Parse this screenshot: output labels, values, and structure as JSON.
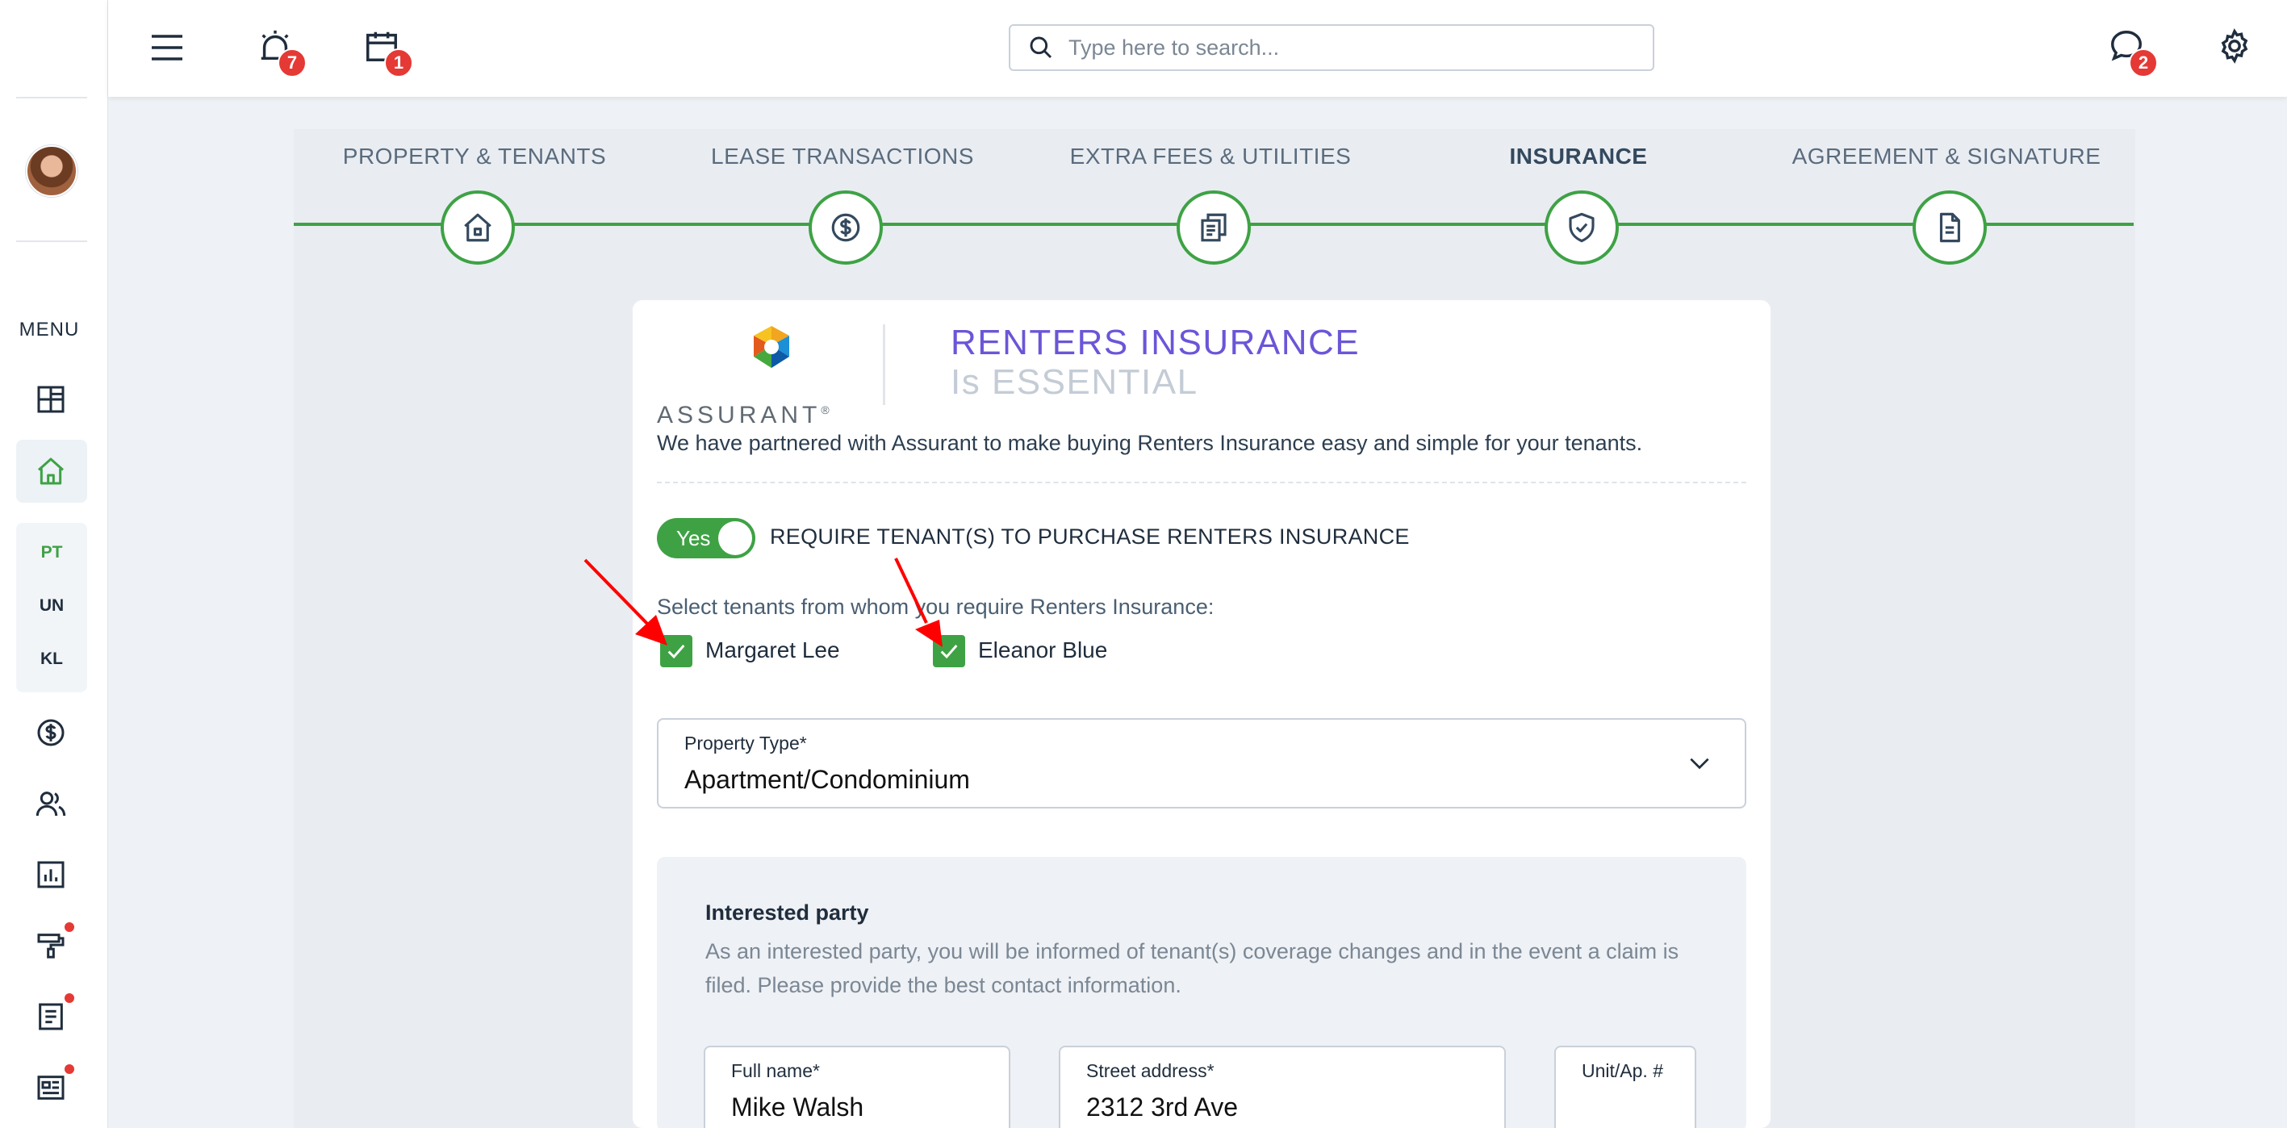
{
  "topbar": {
    "alarm_badge": "7",
    "calendar_badge": "1",
    "chat_badge": "2",
    "search_placeholder": "Type here to search..."
  },
  "sidebar": {
    "menu_label": "MENU",
    "sub_items": [
      "PT",
      "UN",
      "KL"
    ]
  },
  "stepper": {
    "steps": [
      {
        "label": "PROPERTY & TENANTS",
        "icon": "house-icon"
      },
      {
        "label": "LEASE TRANSACTIONS",
        "icon": "dollar-icon"
      },
      {
        "label": "EXTRA FEES & UTILITIES",
        "icon": "bills-icon"
      },
      {
        "label": "INSURANCE",
        "icon": "shield-check-icon",
        "active": true
      },
      {
        "label": "AGREEMENT & SIGNATURE",
        "icon": "document-icon"
      }
    ]
  },
  "insurance": {
    "brand": "ASSURANT",
    "brand_mark": "®",
    "title": "RENTERS INSURANCE",
    "subtitle": "Is ESSENTIAL",
    "partner_text": "We have partnered with Assurant to make buying Renters Insurance easy and simple for your tenants.",
    "toggle_label": "Yes",
    "require_label": "REQUIRE TENANT(S) TO PURCHASE RENTERS INSURANCE",
    "select_label": "Select tenants from whom you require Renters Insurance:",
    "tenants": [
      {
        "name": "Margaret Lee",
        "checked": true
      },
      {
        "name": "Eleanor Blue",
        "checked": true
      }
    ],
    "property_type_label": "Property Type*",
    "property_type_value": "Apartment/Condominium"
  },
  "interested_party": {
    "title": "Interested party",
    "description": "As an interested party, you will be informed of tenant(s) coverage changes and in the event a claim is filed. Please provide the best contact information.",
    "full_name_label": "Full name*",
    "full_name_value": "Mike Walsh",
    "street_label": "Street address*",
    "street_value": "2312 3rd Ave",
    "unit_label": "Unit/Ap. #",
    "unit_value": ""
  },
  "colors": {
    "accent_green": "#3ea244",
    "title_purple": "#6a56d8",
    "badge_red": "#e53935",
    "annotation_red": "#ff0000"
  }
}
